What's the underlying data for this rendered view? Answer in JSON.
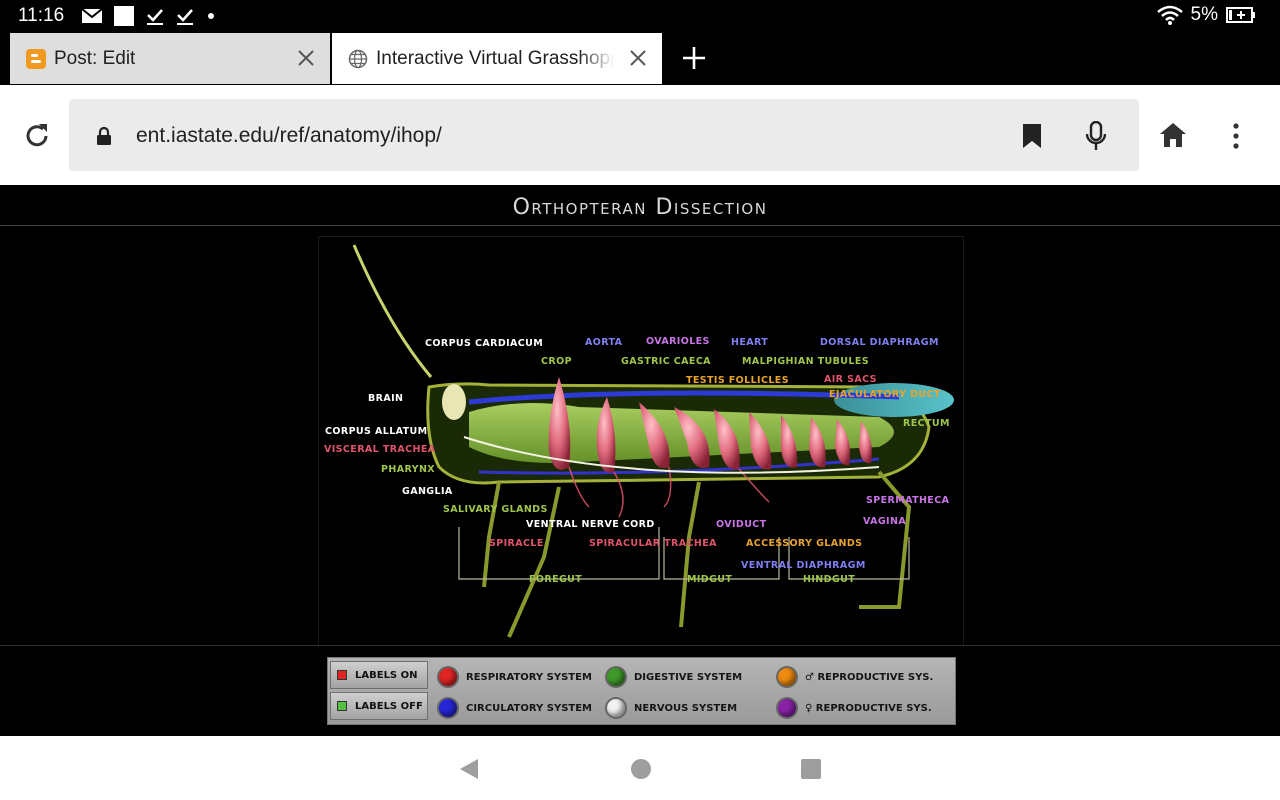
{
  "status": {
    "time": "11:16",
    "battery": "5%"
  },
  "tabs": [
    {
      "title": "Post: Edit"
    },
    {
      "title": "Interactive Virtual Grasshopper"
    }
  ],
  "omnibox": {
    "url": "ent.iastate.edu/ref/anatomy/ihop/"
  },
  "page": {
    "banner_title": "Orthopteran Dissection",
    "diagram_labels": {
      "corpus_cardiacum": "CORPUS CARDIACUM",
      "aorta": "AORTA",
      "ovarioles": "OVARIOLES",
      "heart": "HEART",
      "dorsal_diaphragm": "DORSAL DIAPHRAGM",
      "crop": "CROP",
      "gastric_caeca": "GASTRIC CAECA",
      "malpighian_tubules": "MALPIGHIAN TUBULES",
      "testis_follicles": "TESTIS FOLLICLES",
      "air_sacs": "AIR SACS",
      "ejaculatory_duct": "EJACULATORY DUCT",
      "brain": "BRAIN",
      "rectum": "RECTUM",
      "corpus_allatum": "CORPUS ALLATUM",
      "visceral_trachea": "VISCERAL TRACHEA",
      "pharynx": "PHARYNX",
      "ganglia": "GANGLIA",
      "spermatheca": "SPERMATHECA",
      "salivary_glands": "SALIVARY GLANDS",
      "ventral_nerve_cord": "VENTRAL NERVE CORD",
      "oviduct": "OVIDUCT",
      "vagina": "VAGINA",
      "spiracle": "SPIRACLE",
      "spiracular_trachea": "SPIRACULAR TRACHEA",
      "accessory_glands": "ACCESSORY GLANDS",
      "ventral_diaphragm": "VENTRAL DIAPHRAGM",
      "foregut": "FOREGUT",
      "midgut": "MIDGUT",
      "hindgut": "HINDGUT"
    },
    "controls": {
      "labels_on": "LABELS ON",
      "labels_off": "LABELS OFF",
      "systems": {
        "respiratory": "RESPIRATORY SYSTEM",
        "circulatory": "CIRCULATORY SYSTEM",
        "digestive": "DIGESTIVE SYSTEM",
        "nervous": "NERVOUS SYSTEM",
        "male_reproductive": "♂ REPRODUCTIVE SYS.",
        "female_reproductive": "♀ REPRODUCTIVE SYS."
      }
    }
  },
  "colors": {
    "respiratory": "#e02525",
    "circulatory": "#2626d8",
    "digestive": "#3f9a2a",
    "nervous": "#f2f2f2",
    "male_reproductive": "#ef8a10",
    "female_reproductive": "#8a22a8"
  },
  "icons": [
    "mail-icon",
    "checkbox-icon",
    "wifi-icon",
    "battery-icon",
    "reload-icon",
    "lock-icon",
    "bookmark-icon",
    "mic-icon",
    "home-icon",
    "more-icon",
    "globe-icon",
    "blogger-icon",
    "close-icon",
    "plus-icon",
    "back-icon",
    "home-circle-icon",
    "recents-icon"
  ]
}
